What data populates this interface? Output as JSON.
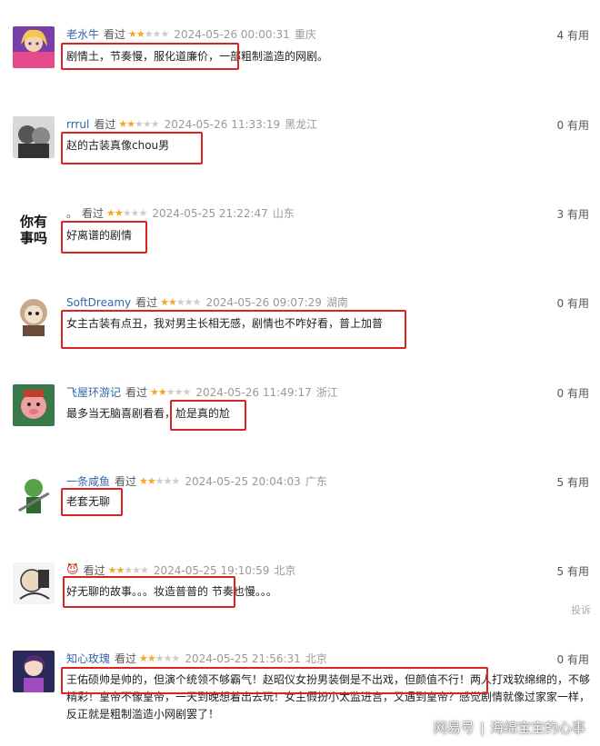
{
  "reviews": [
    {
      "name": "老水牛",
      "seen": "看过",
      "rating": 2,
      "time": "2024-05-26 00:00:31",
      "location": "重庆",
      "useful": "4 有用",
      "comment": "剧情土，节奏慢，服化道廉价，一部粗制滥造的网剧。",
      "avatar": "anime-girl-avatar"
    },
    {
      "name": "rrrul",
      "seen": "看过",
      "rating": 2,
      "time": "2024-05-26 11:33:19",
      "location": "黑龙江",
      "useful": "0 有用",
      "comment": "赵的古装真像chou男",
      "avatar": "photo-avatar"
    },
    {
      "name": "。",
      "seen": "看过",
      "rating": 2,
      "time": "2024-05-25 21:22:47",
      "location": "山东",
      "useful": "3 有用",
      "comment": "好离谱的剧情",
      "avatar_text_line1": "你有",
      "avatar_text_line2": "事吗"
    },
    {
      "name": "SoftDreamy",
      "seen": "看过",
      "rating": 2,
      "time": "2024-05-26 09:07:29",
      "location": "湖南",
      "useful": "0 有用",
      "comment": "女主古装有点丑，我对男主长相无感，剧情也不咋好看，普上加普",
      "avatar": "cartoon-avatar"
    },
    {
      "name": "飞屋环游记",
      "seen": "看过",
      "rating": 2,
      "time": "2024-05-26 11:49:17",
      "location": "浙江",
      "useful": "0 有用",
      "comment_pre": "最多当无脑喜剧看看，",
      "comment_hl": "尬是真的尬",
      "avatar": "cartoon-pig-avatar"
    },
    {
      "name": "一条咸鱼",
      "seen": "看过",
      "rating": 2,
      "time": "2024-05-25 20:04:03",
      "location": "广东",
      "useful": "5 有用",
      "comment": "老套无聊",
      "avatar": "anime-swordsman-avatar"
    },
    {
      "name": "",
      "seen": "看过",
      "rating": 2,
      "time": "2024-05-25 19:10:59",
      "location": "北京",
      "useful": "5 有用",
      "comment_hl": "好无聊的故事。。。妆造普普的",
      "comment_post": " 节奏也慢。。。",
      "avatar": "sketch-avatar",
      "report": "投诉"
    },
    {
      "name": "知心玫瑰",
      "seen": "看过",
      "rating": 2,
      "time": "2024-05-25 21:56:31",
      "location": "北京",
      "useful": "0 有用",
      "comment_hl": "王佑硕帅是帅的，但演个统领不够霸气！赵昭仪女扮男装倒是不出戏，但颜值不行！",
      "comment_post": "两人打戏软绵绵的，不够精彩！皇帝不像皇帝，一天到晚想着出去玩！女主假扮小太监进宫，又遇到皇帝？感觉剧情就像过家家一样，反正就是粗制滥造小网剧罢了！",
      "avatar": "anime-warrior-avatar"
    }
  ],
  "watermark": {
    "left": "网易号",
    "right": "海绵宝宝的心事"
  },
  "colors": {
    "name": "#3366aa",
    "star_on": "#f5a623",
    "star_off": "#cccccc",
    "highlight": "#dd2222"
  }
}
